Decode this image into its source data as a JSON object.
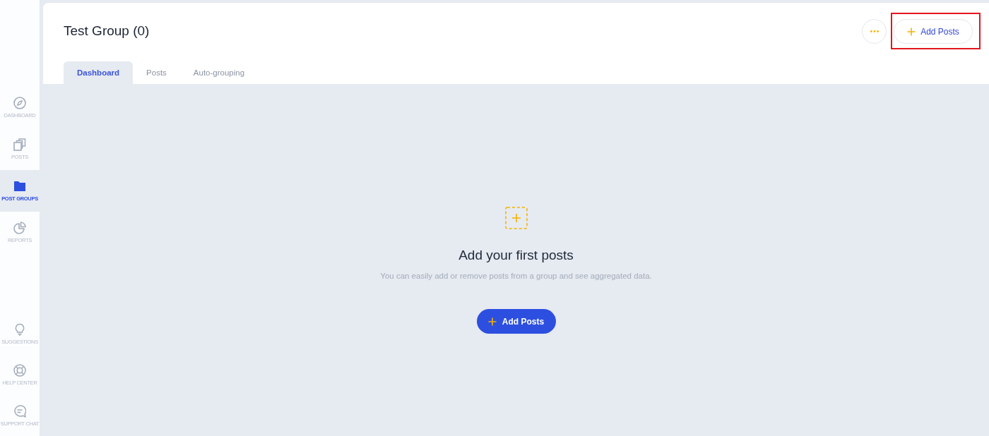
{
  "sidebar": {
    "items": [
      {
        "label": "DASHBOARD",
        "selected": false
      },
      {
        "label": "POSTS",
        "selected": false
      },
      {
        "label": "POST GROUPS",
        "selected": true
      },
      {
        "label": "REPORTS",
        "selected": false
      }
    ],
    "bottom_items": [
      {
        "label": "SUGGESTIONS",
        "selected": false
      },
      {
        "label": "HELP CENTER",
        "selected": false
      },
      {
        "label": "SUPPORT CHAT",
        "selected": false
      }
    ]
  },
  "header": {
    "title": "Test Group (0)",
    "add_button": {
      "label": "Add Posts",
      "highlighted": true
    }
  },
  "tabs": [
    {
      "label": "Dashboard",
      "selected": true
    },
    {
      "label": "Posts",
      "selected": false
    },
    {
      "label": "Auto-grouping",
      "selected": false
    }
  ],
  "empty_state": {
    "title": "Add your first posts",
    "text": "You can easily add or remove posts from a group and see aggregated data.",
    "button": {
      "label": "Add Posts"
    }
  }
}
